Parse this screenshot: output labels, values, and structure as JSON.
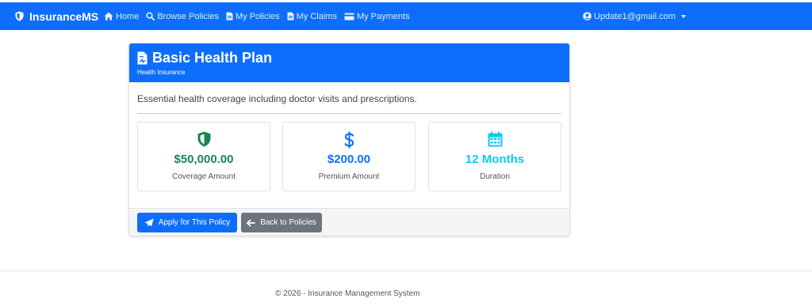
{
  "navbar": {
    "brand": "InsuranceMS",
    "brand_icon": "shield-icon",
    "links": [
      {
        "label": "Home",
        "icon": "home-icon"
      },
      {
        "label": "Browse Policies",
        "icon": "search-icon"
      },
      {
        "label": "My Policies",
        "icon": "file-icon"
      },
      {
        "label": "My Claims",
        "icon": "file-icon"
      },
      {
        "label": "My Payments",
        "icon": "credit-card-icon"
      }
    ],
    "user": "Update1@gmail.com"
  },
  "policy": {
    "title": "Basic Health Plan",
    "category": "Health Insurance",
    "description": "Essential health coverage including doctor visits and prescriptions.",
    "stats": [
      {
        "value": "$50,000.00",
        "label": "Coverage Amount",
        "icon": "shield-icon",
        "color": "#198754"
      },
      {
        "value": "$200.00",
        "label": "Premium Amount",
        "icon": "dollar-icon",
        "color": "#0d6efd"
      },
      {
        "value": "12 Months",
        "label": "Duration",
        "icon": "calendar-icon",
        "color": "#0dcaf0"
      }
    ]
  },
  "actions": {
    "apply_label": "Apply for This Policy",
    "back_label": "Back to Policies"
  },
  "footer": {
    "text": "© 2026 - Insurance Management System"
  },
  "colors": {
    "primary": "#0d6efd",
    "secondary": "#6c757d",
    "success": "#198754",
    "info": "#0dcaf0"
  }
}
